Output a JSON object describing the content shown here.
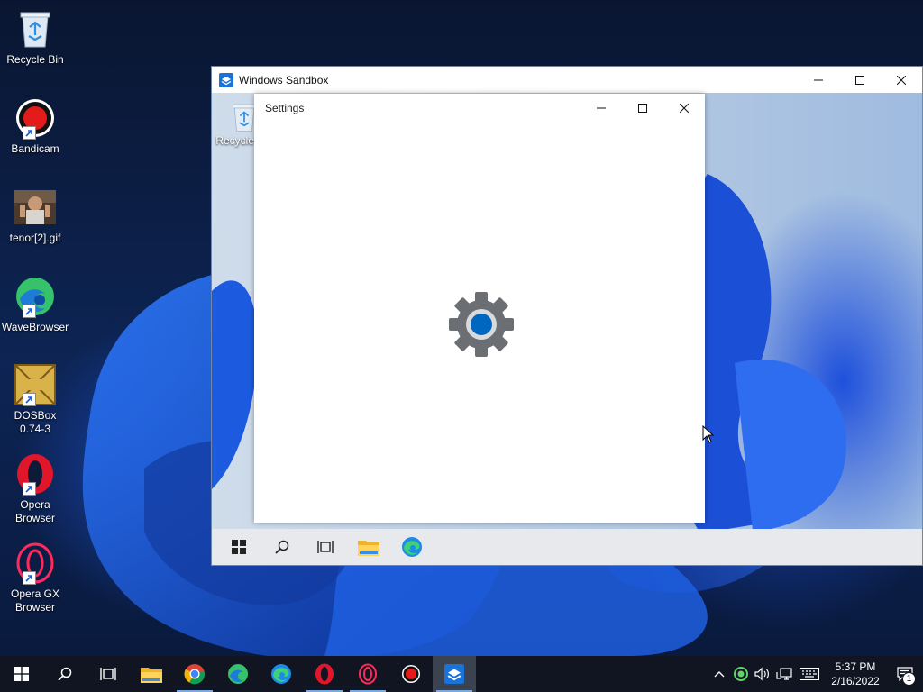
{
  "desktop": {
    "icons": [
      {
        "label": "Recycle Bin",
        "icon": "recycle-bin-icon"
      },
      {
        "label": "Bandicam",
        "icon": "bandicam-icon"
      },
      {
        "label": "tenor[2].gif",
        "icon": "gif-thumbnail-icon"
      },
      {
        "label": "WaveBrowser",
        "icon": "wavebrowser-icon"
      },
      {
        "label": "DOSBox\n0.74-3",
        "icon": "dosbox-icon"
      },
      {
        "label": "Opera\nBrowser",
        "icon": "opera-icon"
      },
      {
        "label": "Opera GX\nBrowser",
        "icon": "opera-gx-icon"
      }
    ]
  },
  "sandbox": {
    "title": "Windows Sandbox",
    "desktop_icon_label": "Recycle Bin",
    "taskbar": [
      "start-icon",
      "search-icon",
      "task-view-icon",
      "file-explorer-icon",
      "edge-icon"
    ]
  },
  "settings": {
    "title": "Settings"
  },
  "taskbar": {
    "apps": [
      {
        "icon": "search-icon",
        "running": false
      },
      {
        "icon": "task-view-icon",
        "running": false
      },
      {
        "icon": "file-explorer-icon",
        "running": false
      },
      {
        "icon": "chrome-icon",
        "running": true
      },
      {
        "icon": "edge-icon",
        "running": false
      },
      {
        "icon": "edge-icon",
        "running": false
      },
      {
        "icon": "opera-icon",
        "running": true
      },
      {
        "icon": "opera-gx-icon",
        "running": true
      },
      {
        "icon": "bandicam-icon",
        "running": false
      },
      {
        "icon": "windows-sandbox-icon",
        "running": true
      }
    ],
    "time": "5:37 PM",
    "date": "2/16/2022",
    "notification_count": "1"
  },
  "colors": {
    "accent": "#0067c0",
    "taskbar": "#101521",
    "settings_gear": "#6b6e73"
  }
}
